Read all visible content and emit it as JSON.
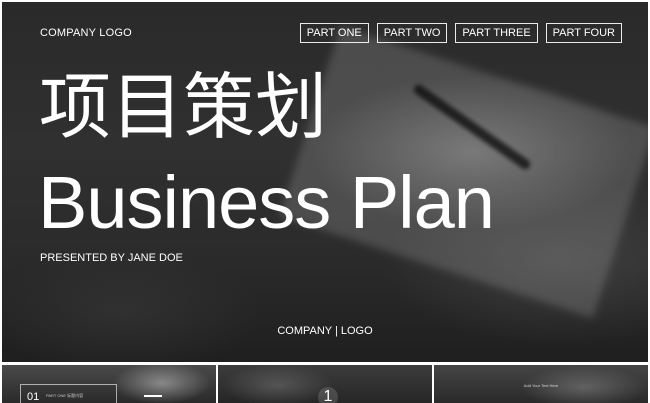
{
  "header": {
    "logo": "COMPANY LOGO",
    "nav": [
      "PART ONE",
      "PART TWO",
      "PART THREE",
      "PART FOUR"
    ]
  },
  "hero": {
    "title_cn": "项目策划",
    "title_en": "Business Plan",
    "presented_by": "PRESENTED BY JANE DOE"
  },
  "footer": {
    "text": "COMPANY | LOGO"
  },
  "thumbnails": [
    {
      "number": "01",
      "subtitle": "PART ONE  标题内容"
    },
    {
      "number": "1"
    },
    {
      "text": "Add Your Text Here"
    }
  ]
}
